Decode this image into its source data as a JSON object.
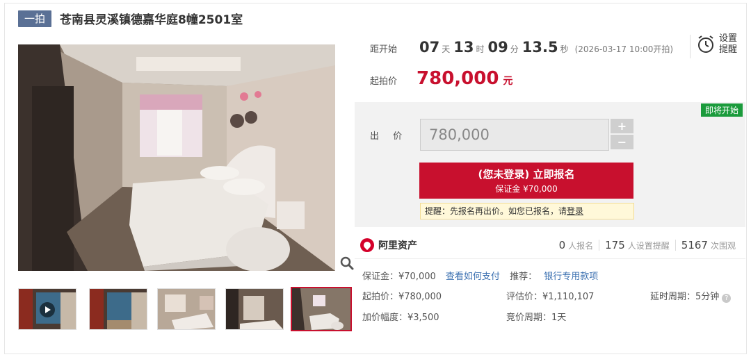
{
  "header": {
    "tag": "一拍",
    "title": "苍南县灵溪镇德嘉华庭8幢2501室"
  },
  "countdown": {
    "label": "距开始",
    "days": "07",
    "days_unit": "天",
    "hours": "13",
    "hours_unit": "时",
    "minutes": "09",
    "minutes_unit": "分",
    "seconds": "13.5",
    "seconds_unit": "秒",
    "start_time": "(2026-03-17 10:00开拍)"
  },
  "reminder": {
    "label": "设置提醒",
    "icon": "alarm-clock-icon"
  },
  "start_price": {
    "label": "起拍价",
    "value": "780,000",
    "unit": "元"
  },
  "bid": {
    "status_badge": "即将开始",
    "label": "出 价",
    "input_value": "780,000",
    "plus": "+",
    "minus": "−",
    "signup_line1": "(您未登录) 立即报名",
    "signup_line2": "保证金 ¥70,000",
    "tip_prefix": "提醒：先报名再出价。如您已报名，请",
    "tip_link": "登录"
  },
  "platform": {
    "name": "阿里资产",
    "signups": "0",
    "signups_label": "人报名",
    "reminders": "175",
    "reminders_label": "人设置提醒",
    "views": "5167",
    "views_label": "次围观"
  },
  "details": {
    "deposit": "保证金：¥70,000",
    "how_to_pay": "查看如何支付",
    "recommend_label": "推荐：",
    "recommend_link": "银行专用款项",
    "start_price": "起拍价：¥780,000",
    "appraisal": "评估价：¥1,110,107",
    "delay": "延时周期：5分钟",
    "increment": "加价幅度：¥3,500",
    "period": "竞价周期：1天"
  },
  "colors": {
    "accent_red": "#c8102e",
    "tag_blue": "#5a7095",
    "badge_green": "#1b9b3c",
    "link_blue": "#3a6fb0"
  }
}
